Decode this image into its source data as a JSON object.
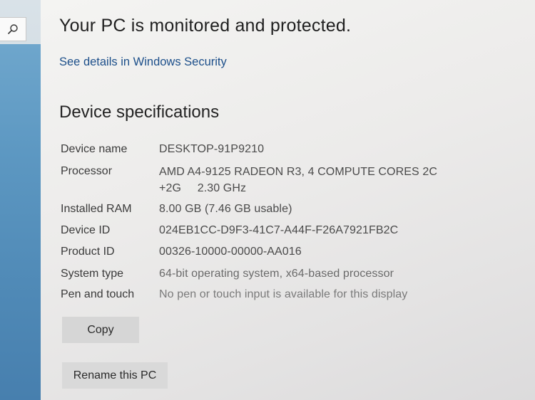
{
  "search": {
    "icon": "search-icon"
  },
  "protection": {
    "headline": "Your PC is monitored and protected.",
    "link": "See details in Windows Security"
  },
  "device_specs": {
    "title": "Device specifications",
    "rows": [
      {
        "label": "Device name",
        "value": "DESKTOP-91P9210"
      },
      {
        "label": "Processor",
        "value_line1": "AMD A4-9125 RADEON R3, 4 COMPUTE CORES 2C",
        "value_line2": "+2G     2.30 GHz"
      },
      {
        "label": "Installed RAM",
        "value": "8.00 GB (7.46 GB usable)"
      },
      {
        "label": "Device ID",
        "value": "024EB1CC-D9F3-41C7-A44F-F26A7921FB2C"
      },
      {
        "label": "Product ID",
        "value": "00326-10000-00000-AA016"
      },
      {
        "label": "System type",
        "value": "64-bit operating system, x64-based processor"
      },
      {
        "label": "Pen and touch",
        "value": "No pen or touch input is available for this display"
      }
    ]
  },
  "buttons": {
    "copy": "Copy",
    "rename": "Rename this PC"
  },
  "colors": {
    "link": "#1c4f8a",
    "accent_strip": "#5d98c2",
    "button_bg": "#d6d6d6"
  }
}
